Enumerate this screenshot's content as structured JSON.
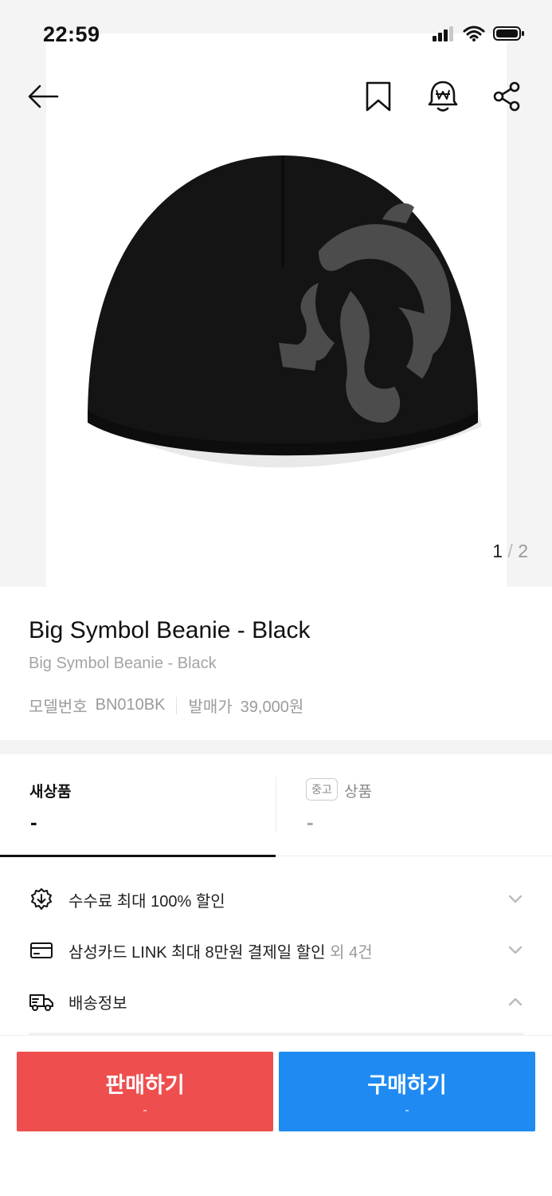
{
  "status_bar": {
    "time": "22:59",
    "icons": [
      "signal-icon",
      "wifi-icon",
      "battery-icon"
    ]
  },
  "top_nav": {
    "back_icon": "arrow-left-icon",
    "bookmark_icon": "bookmark-icon",
    "price_alert_icon": "bell-won-icon",
    "share_icon": "share-icon"
  },
  "gallery": {
    "current": "1",
    "separator": "/",
    "total": "2"
  },
  "product": {
    "title": "Big Symbol Beanie - Black",
    "subtitle": "Big Symbol Beanie - Black",
    "model_label": "모델번호",
    "model_value": "BN010BK",
    "release_label": "발매가",
    "release_value": "39,000원"
  },
  "tabs": {
    "new": {
      "label": "새상품",
      "price": "-"
    },
    "used": {
      "badge": "중고",
      "label": "상품",
      "price": "-"
    }
  },
  "benefits": [
    {
      "icon": "discount-badge-icon",
      "text": "수수료 최대 100% 할인",
      "extra": "",
      "chevron": "chevron-down-icon"
    },
    {
      "icon": "credit-card-icon",
      "text": "삼성카드 LINK 최대 8만원 결제일 할인",
      "extra": " 외 4건",
      "chevron": "chevron-down-icon"
    },
    {
      "icon": "delivery-truck-icon",
      "text": "배송정보",
      "extra": "",
      "chevron": "chevron-up-icon"
    }
  ],
  "actions": {
    "sell": {
      "label": "판매하기",
      "price": "-"
    },
    "buy": {
      "label": "구매하기",
      "price": "-"
    }
  },
  "colors": {
    "sell": "#ef4e4e",
    "buy": "#1f8bf2",
    "background_gray": "#f4f4f4"
  }
}
